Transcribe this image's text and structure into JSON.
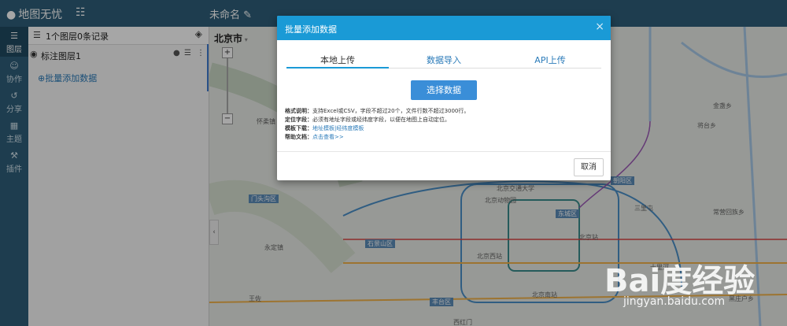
{
  "topbar": {
    "brand": "地图无忧",
    "doc_title": "未命名"
  },
  "rail": [
    {
      "label": "图层",
      "icon": "layers-icon",
      "active": true
    },
    {
      "label": "协作",
      "icon": "users-icon",
      "active": false
    },
    {
      "label": "分享",
      "icon": "share-icon",
      "active": false
    },
    {
      "label": "主题",
      "icon": "theme-icon",
      "active": false
    },
    {
      "label": "插件",
      "icon": "plugin-icon",
      "active": false
    }
  ],
  "panel": {
    "header": "1个图层0条记录",
    "layer_name": "标注图层1",
    "add_data": "⊕批量添加数据"
  },
  "map": {
    "city": "北京市",
    "labels": {
      "l1": "门头沟区",
      "l2": "石景山区",
      "l3": "丰台区",
      "l4": "东城区",
      "l5": "朝阳区",
      "l6": "北京动物园",
      "l7": "北京交通大学",
      "l8": "北京站",
      "l9": "北京西站",
      "l10": "北京南站",
      "l11": "怀柔镇",
      "l12": "永定镇",
      "l13": "王佐",
      "l14": "十里河",
      "l15": "三里屯",
      "l16": "西红门",
      "l17": "将台乡",
      "l18": "金盏乡",
      "l19": "常营回族乡",
      "l20": "黑庄户乡"
    }
  },
  "modal": {
    "title": "批量添加数据",
    "tabs": [
      "本地上传",
      "数据导入",
      "API上传"
    ],
    "button": "选择数据",
    "info": {
      "format_key": "格式说明：",
      "format_val": "支持Excel或CSV，字段不超过20个，文件行数不超过3000行。",
      "locate_key": "定位字段：",
      "locate_val": "必须有地址字段或经纬度字段，以便在地图上自动定位。",
      "template_key": "模板下载：",
      "template_link1": "地址模板",
      "template_sep": "|",
      "template_link2": "经纬度模板",
      "help_key": "帮助文档：",
      "help_link": "点击查看>>"
    },
    "cancel": "取消"
  },
  "watermark": {
    "brand": "Bai度经验",
    "sub": "jingyan.baidu.com"
  }
}
